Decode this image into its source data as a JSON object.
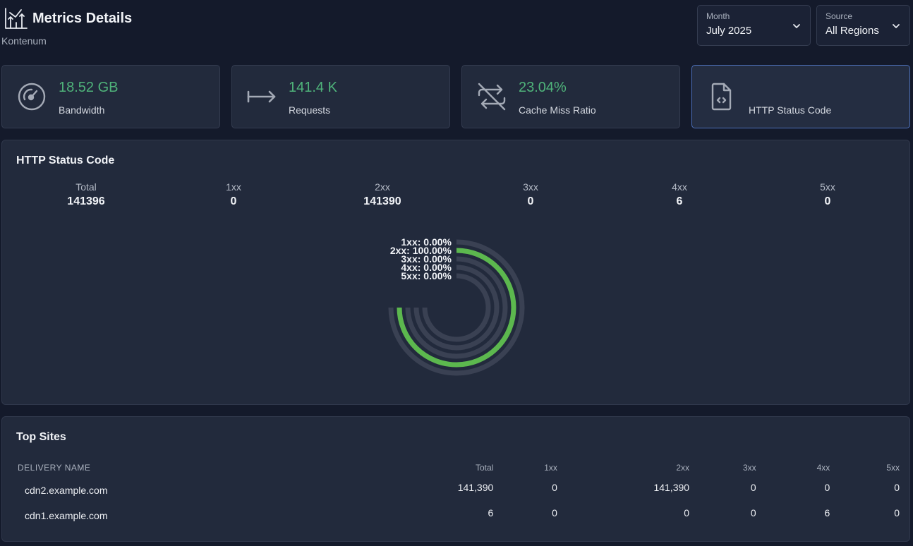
{
  "header": {
    "title": "Metrics Details",
    "subtitle": "Kontenum",
    "month": {
      "label": "Month",
      "value": "July 2025"
    },
    "source": {
      "label": "Source",
      "value": "All Regions"
    }
  },
  "cards": [
    {
      "value": "18.52 GB",
      "label": "Bandwidth",
      "icon": "speedometer-icon"
    },
    {
      "value": "141.4 K",
      "label": "Requests",
      "icon": "arrow-right-icon"
    },
    {
      "value": "23.04%",
      "label": "Cache Miss Ratio",
      "icon": "repeat-off-icon"
    },
    {
      "value": "",
      "label": "HTTP Status Code",
      "icon": "file-code-icon"
    }
  ],
  "status_panel": {
    "title": "HTTP Status Code",
    "stats": [
      {
        "label": "Total",
        "value": "141396"
      },
      {
        "label": "1xx",
        "value": "0"
      },
      {
        "label": "2xx",
        "value": "141390"
      },
      {
        "label": "3xx",
        "value": "0"
      },
      {
        "label": "4xx",
        "value": "6"
      },
      {
        "label": "5xx",
        "value": "0"
      }
    ]
  },
  "chart_data": {
    "type": "radial-bar",
    "categories": [
      "1xx",
      "2xx",
      "3xx",
      "4xx",
      "5xx"
    ],
    "values": [
      0.0,
      100.0,
      0.0,
      0.0,
      0.0
    ],
    "labels": [
      "1xx: 0.00%",
      "2xx: 100.00%",
      "3xx: 0.00%",
      "4xx: 0.00%",
      "5xx: 0.00%"
    ],
    "max": 100,
    "colors": {
      "fill": "#5cb84e",
      "track": "#3a4153"
    }
  },
  "top_sites": {
    "title": "Top Sites",
    "columns": [
      "DELIVERY NAME",
      "Total",
      "1xx",
      "2xx",
      "3xx",
      "4xx",
      "5xx"
    ],
    "rows": [
      [
        "cdn2.example.com",
        "141,390",
        "0",
        "141,390",
        "0",
        "0",
        "0"
      ],
      [
        "cdn1.example.com",
        "6",
        "0",
        "0",
        "0",
        "6",
        "0"
      ]
    ]
  }
}
